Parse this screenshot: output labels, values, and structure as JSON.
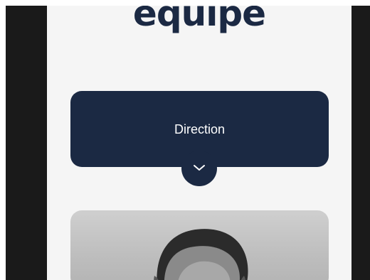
{
  "section": {
    "heading": "équipe"
  },
  "department_selector": {
    "label": "Direction",
    "toggle_icon": "chevron-down-icon"
  },
  "team_member": {
    "photo_icon": "portrait-photo"
  },
  "colors": {
    "navy": "#1b2943",
    "page_background": "#f5f5f5",
    "frame": "#1a1a1a"
  }
}
